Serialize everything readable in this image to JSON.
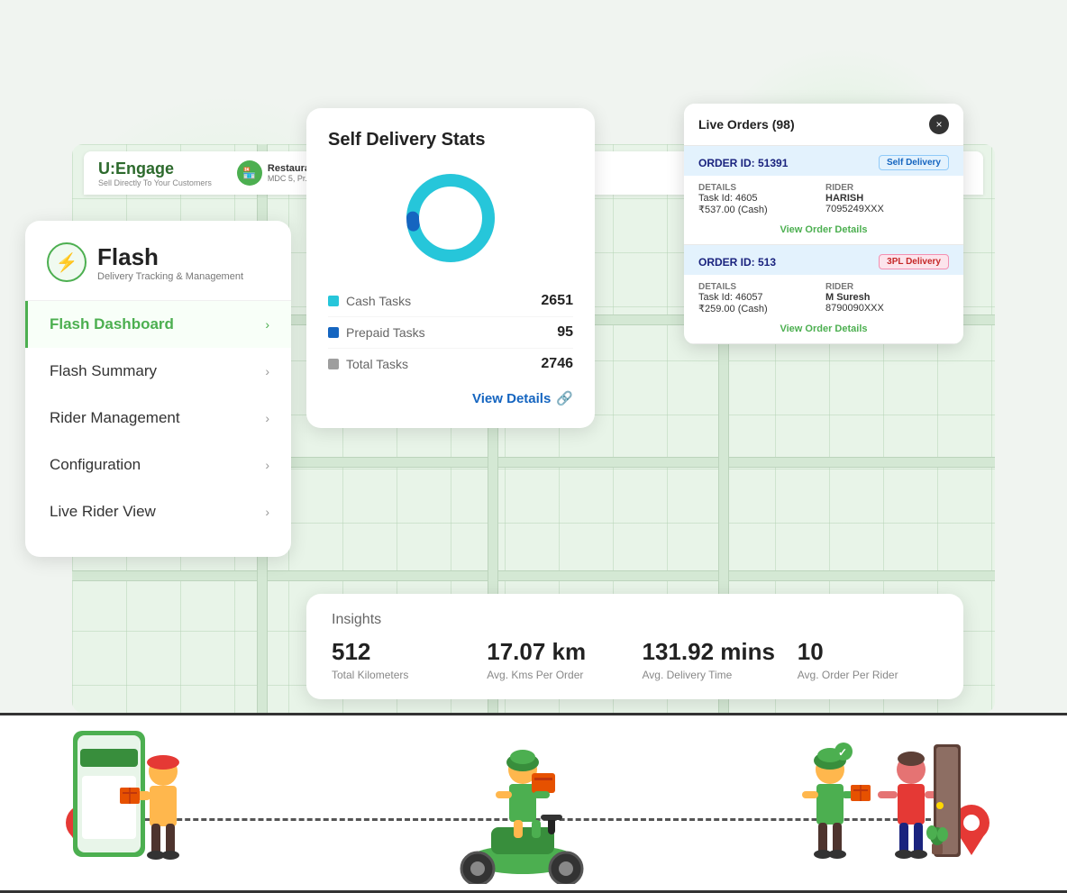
{
  "app": {
    "title": "Flash - Delivery Tracking & Management"
  },
  "header": {
    "logo_text": "U:Engage",
    "logo_sub": "Sell Directly To Your Customers",
    "restaurant_name": "Restaura...",
    "restaurant_sub": "MDC 5, Pr..."
  },
  "flash_brand": {
    "icon": "⚡",
    "title": "Flash",
    "subtitle": "Delivery Tracking & Management"
  },
  "sidebar": {
    "items": [
      {
        "label": "Flash Dashboard",
        "active": true,
        "chevron": "›"
      },
      {
        "label": "Flash Summary",
        "active": false,
        "chevron": "›"
      },
      {
        "label": "Rider Management",
        "active": false,
        "chevron": "›"
      },
      {
        "label": "Configuration",
        "active": false,
        "chevron": "›"
      },
      {
        "label": "Live Rider View",
        "active": false,
        "chevron": "›"
      }
    ]
  },
  "stats_card": {
    "title": "Self Delivery Stats",
    "rows": [
      {
        "label": "Cash Tasks",
        "value": "2651",
        "dot": "teal"
      },
      {
        "label": "Prepaid Tasks",
        "value": "95",
        "dot": "blue"
      },
      {
        "label": "Total Tasks",
        "value": "2746",
        "dot": "gray"
      }
    ],
    "view_details": "View Details",
    "donut": {
      "teal_percent": 97,
      "blue_percent": 3
    }
  },
  "live_orders": {
    "title": "Live Orders (98)",
    "count": 98,
    "close_icon": "×",
    "orders": [
      {
        "order_id": "ORDER ID: 51391",
        "badge": "Self Delivery",
        "badge_type": "self",
        "details_label": "Details",
        "task_id": "Task Id: 4605",
        "amount": "₹537.00 (Cash)",
        "rider_label": "Rider",
        "rider_name": "HARISH",
        "rider_phone": "7095249XXX",
        "view_link": "View Order Details"
      },
      {
        "order_id": "ORDER ID: 513",
        "badge": "3PL Delivery",
        "badge_type": "3pl",
        "details_label": "Details",
        "task_id": "Task Id: 46057",
        "amount": "₹259.00 (Cash)",
        "rider_label": "Rider",
        "rider_name": "M Suresh",
        "rider_phone": "8790090XXX",
        "view_link": "View Order Details"
      }
    ]
  },
  "insights": {
    "title": "Insights",
    "metrics": [
      {
        "value": "512",
        "label": "Total Kilometers"
      },
      {
        "value": "17.07 km",
        "label": "Avg. Kms Per Order"
      },
      {
        "value": "131.92 mins",
        "label": "Avg. Delivery Time"
      },
      {
        "value": "10",
        "label": "Avg. Order Per Rider"
      }
    ]
  }
}
